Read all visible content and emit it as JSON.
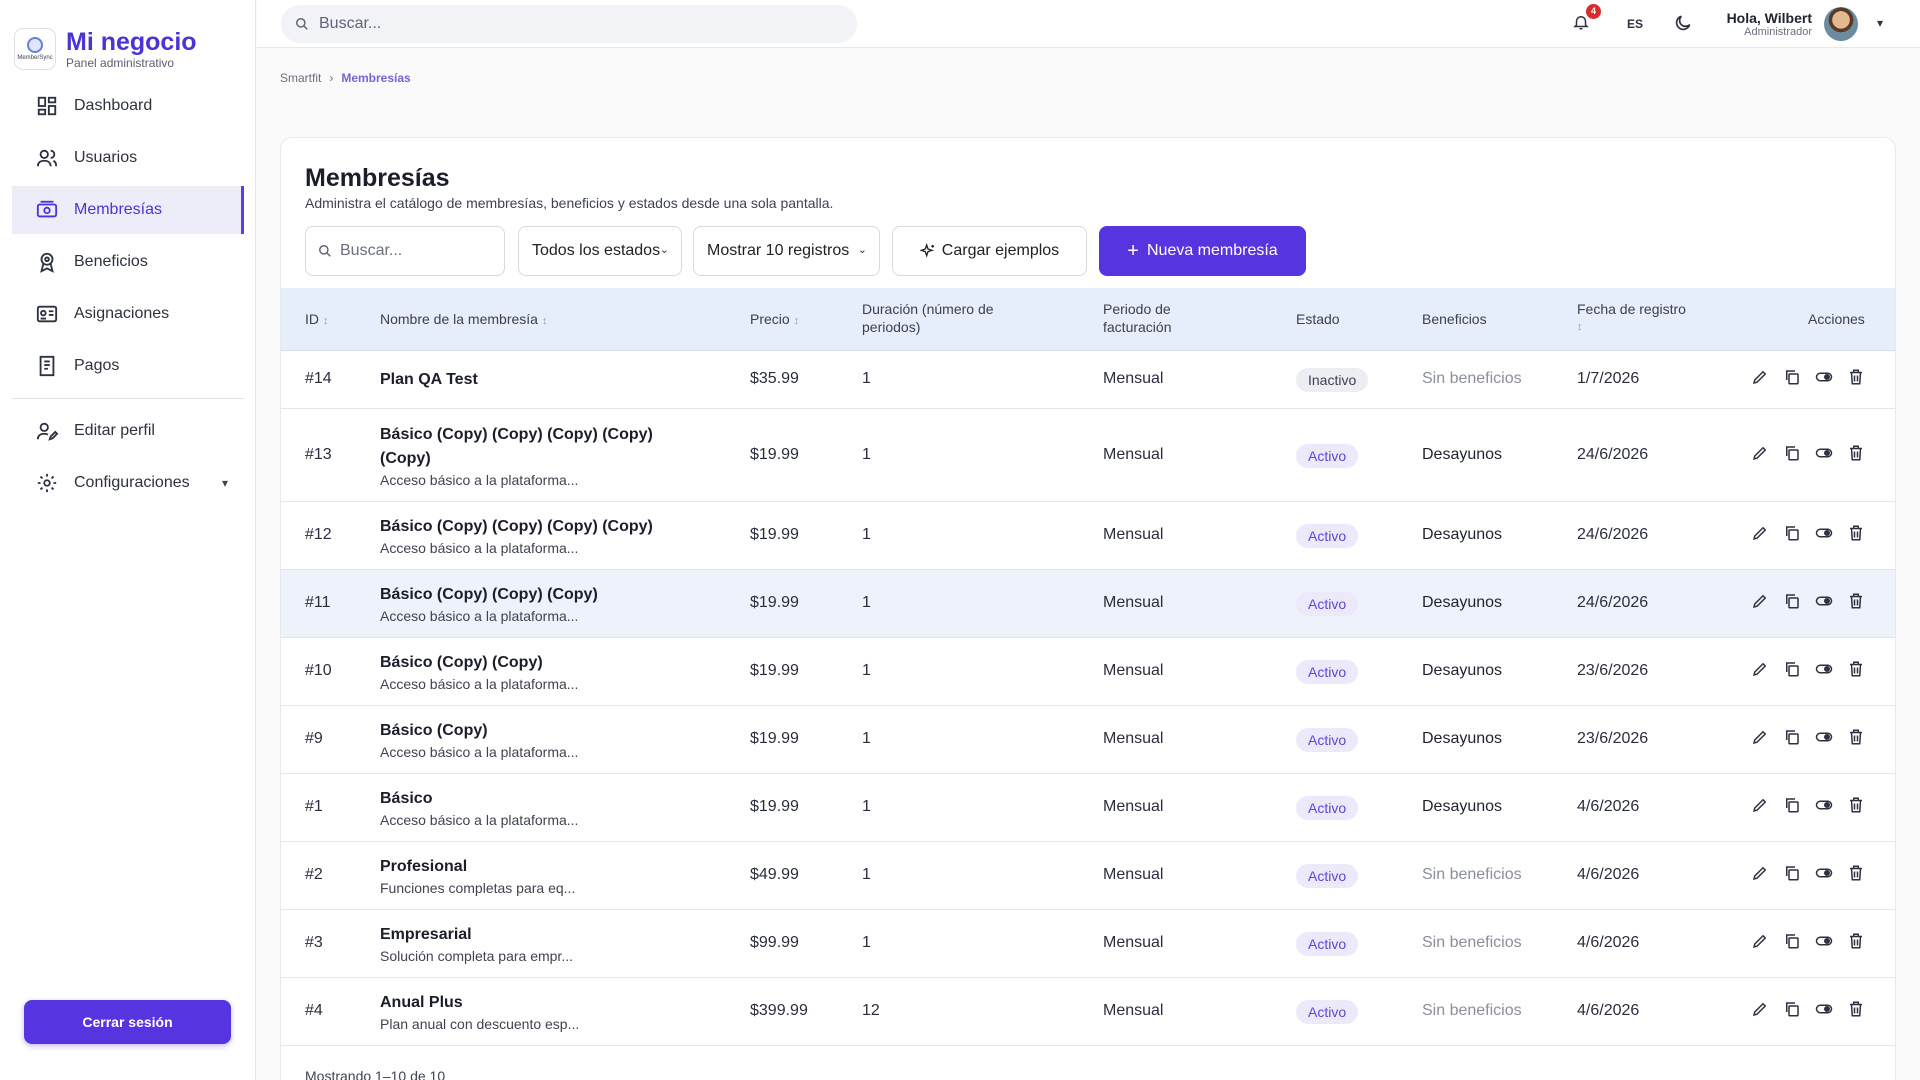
{
  "brand": {
    "title": "Mi negocio",
    "subtitle": "Panel administrativo",
    "logo_text": "MemberSync"
  },
  "sidebar": {
    "items": [
      {
        "label": "Dashboard",
        "icon": "dashboard-icon"
      },
      {
        "label": "Usuarios",
        "icon": "users-icon"
      },
      {
        "label": "Membresías",
        "icon": "membership-icon",
        "active": true
      },
      {
        "label": "Beneficios",
        "icon": "award-icon"
      },
      {
        "label": "Asignaciones",
        "icon": "id-card-icon"
      },
      {
        "label": "Pagos",
        "icon": "receipt-icon"
      }
    ],
    "items2": [
      {
        "label": "Editar perfil",
        "icon": "user-edit-icon"
      },
      {
        "label": "Configuraciones",
        "icon": "gear-icon"
      }
    ],
    "logout_label": "Cerrar sesión"
  },
  "topbar": {
    "search_placeholder": "Buscar...",
    "notif_count": "4",
    "lang": "ES",
    "greeting": "Hola, Wilbert",
    "role": "Administrador"
  },
  "breadcrumb": {
    "root": "Smartfit",
    "sep": "›",
    "current": "Membresías"
  },
  "page": {
    "title": "Membresías",
    "subtitle": "Administra el catálogo de membresías, beneficios y estados desde una sola pantalla.",
    "search_placeholder": "Buscar...",
    "status_filter": "Todos los estados",
    "page_size": "Mostrar 10 registros",
    "load_examples": "Cargar ejemplos",
    "new_button": "Nueva membresía",
    "footer": "Mostrando 1–10 de 10"
  },
  "table": {
    "headers": {
      "id": "ID",
      "name": "Nombre de la membresía",
      "price": "Precio",
      "duration_1": "Duración (número de",
      "duration_2": "periodos)",
      "period_1": "Periodo de",
      "period_2": "facturación",
      "status": "Estado",
      "benefits": "Beneficios",
      "date": "Fecha de registro",
      "actions": "Acciones"
    },
    "rows": [
      {
        "id": "#14",
        "name": "Plan QA Test",
        "desc": "",
        "price": "$35.99",
        "duration": "1",
        "period": "Mensual",
        "status": "Inactivo",
        "benefits": "Sin beneficios",
        "date": "1/7/2026"
      },
      {
        "id": "#13",
        "name": "Básico (Copy) (Copy) (Copy) (Copy) (Copy)",
        "desc": "Acceso básico a la plataforma...",
        "price": "$19.99",
        "duration": "1",
        "period": "Mensual",
        "status": "Activo",
        "benefits": "Desayunos",
        "date": "24/6/2026"
      },
      {
        "id": "#12",
        "name": "Básico (Copy) (Copy) (Copy) (Copy)",
        "desc": "Acceso básico a la plataforma...",
        "price": "$19.99",
        "duration": "1",
        "period": "Mensual",
        "status": "Activo",
        "benefits": "Desayunos",
        "date": "24/6/2026"
      },
      {
        "id": "#11",
        "name": "Básico (Copy) (Copy) (Copy)",
        "desc": "Acceso básico a la plataforma...",
        "price": "$19.99",
        "duration": "1",
        "period": "Mensual",
        "status": "Activo",
        "benefits": "Desayunos",
        "date": "24/6/2026"
      },
      {
        "id": "#10",
        "name": "Básico (Copy) (Copy)",
        "desc": "Acceso básico a la plataforma...",
        "price": "$19.99",
        "duration": "1",
        "period": "Mensual",
        "status": "Activo",
        "benefits": "Desayunos",
        "date": "23/6/2026"
      },
      {
        "id": "#9",
        "name": "Básico (Copy)",
        "desc": "Acceso básico a la plataforma...",
        "price": "$19.99",
        "duration": "1",
        "period": "Mensual",
        "status": "Activo",
        "benefits": "Desayunos",
        "date": "23/6/2026"
      },
      {
        "id": "#1",
        "name": "Básico",
        "desc": "Acceso básico a la plataforma...",
        "price": "$19.99",
        "duration": "1",
        "period": "Mensual",
        "status": "Activo",
        "benefits": "Desayunos",
        "date": "4/6/2026"
      },
      {
        "id": "#2",
        "name": "Profesional",
        "desc": "Funciones completas para eq...",
        "price": "$49.99",
        "duration": "1",
        "period": "Mensual",
        "status": "Activo",
        "benefits": "Sin beneficios",
        "date": "4/6/2026"
      },
      {
        "id": "#3",
        "name": "Empresarial",
        "desc": "Solución completa para empr...",
        "price": "$99.99",
        "duration": "1",
        "period": "Mensual",
        "status": "Activo",
        "benefits": "Sin beneficios",
        "date": "4/6/2026"
      },
      {
        "id": "#4",
        "name": "Anual Plus",
        "desc": "Plan anual con descuento esp...",
        "price": "$399.99",
        "duration": "12",
        "period": "Mensual",
        "status": "Activo",
        "benefits": "Sin beneficios",
        "date": "4/6/2026"
      }
    ]
  },
  "colors": {
    "accent": "#5635e0",
    "brand": "#4a34d6",
    "header_bg": "#e6edfb"
  }
}
